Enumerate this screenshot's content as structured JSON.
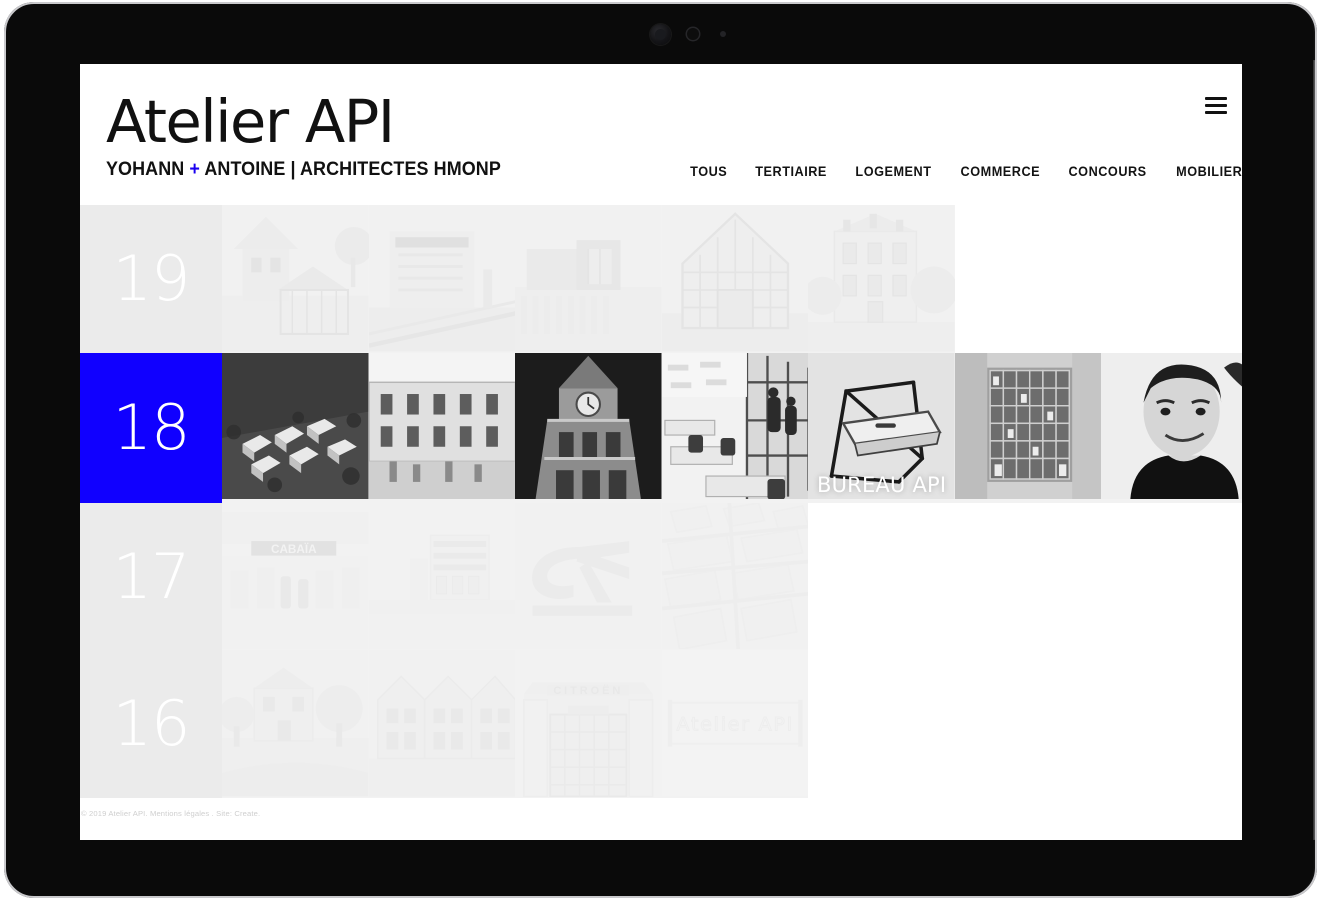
{
  "device": {
    "type": "tablet-mockup",
    "camera_icon": "camera-lens-icon",
    "sensor_icons": [
      "proximity-sensor-icon",
      "light-sensor-icon"
    ]
  },
  "site": {
    "brand": {
      "title": "Atelier API",
      "subtitle_before": "YOHANN ",
      "subtitle_plus": "+",
      "subtitle_after": " ANTOINE | ARCHITECTES HMONP",
      "accent_color": "#1a00f0"
    },
    "menu_icon": "hamburger-menu-icon",
    "nav": [
      {
        "label": "TOUS"
      },
      {
        "label": "TERTIAIRE"
      },
      {
        "label": "LOGEMENT"
      },
      {
        "label": "COMMERCE"
      },
      {
        "label": "CONCOURS"
      },
      {
        "label": "MOBILIER"
      }
    ],
    "footer": {
      "text": "© 2019 Atelier API. Mentions légales . Site: Create."
    }
  },
  "grid": {
    "active_year": "18",
    "active_color": "#1000ff",
    "year_bg": "#ebebeb",
    "rows": [
      {
        "year": "19",
        "state": "faded",
        "tiles": [
          {
            "name": "maison-veranda",
            "label": ""
          },
          {
            "name": "quai-des-marques",
            "label": ""
          },
          {
            "name": "extension-bois",
            "label": ""
          },
          {
            "name": "serre-pignon-vitre",
            "label": ""
          },
          {
            "name": "maison-de-ville",
            "label": ""
          },
          {
            "name": "empty",
            "label": ""
          },
          {
            "name": "empty",
            "label": ""
          }
        ]
      },
      {
        "year": "18",
        "state": "active",
        "tiles": [
          {
            "name": "maquette-urbaine",
            "label": ""
          },
          {
            "name": "place-de-village",
            "label": ""
          },
          {
            "name": "beffroi-clocher",
            "label": ""
          },
          {
            "name": "bureau-open-space",
            "label": ""
          },
          {
            "name": "table-a-dessin",
            "label": "BUREAU API"
          },
          {
            "name": "bibliotheque-casiers",
            "label": ""
          },
          {
            "name": "portrait-architecte",
            "label": ""
          }
        ]
      },
      {
        "year": "17",
        "state": "faded",
        "tiles": [
          {
            "name": "boutique-cabaia",
            "label": ""
          },
          {
            "name": "immeuble-blanc",
            "label": ""
          },
          {
            "name": "logo-credit-agricole",
            "label": ""
          },
          {
            "name": "plan-masse-aerien",
            "label": ""
          },
          {
            "name": "empty",
            "label": ""
          },
          {
            "name": "empty",
            "label": ""
          },
          {
            "name": "empty",
            "label": ""
          }
        ]
      },
      {
        "year": "16",
        "state": "faded",
        "tiles": [
          {
            "name": "maison-jardin",
            "label": ""
          },
          {
            "name": "logements-pignons",
            "label": ""
          },
          {
            "name": "batiment-citroen",
            "label": ""
          },
          {
            "name": "croquis-atelier-api",
            "label": "Atelier API"
          },
          {
            "name": "empty",
            "label": ""
          },
          {
            "name": "empty",
            "label": ""
          },
          {
            "name": "empty",
            "label": ""
          }
        ]
      }
    ]
  }
}
